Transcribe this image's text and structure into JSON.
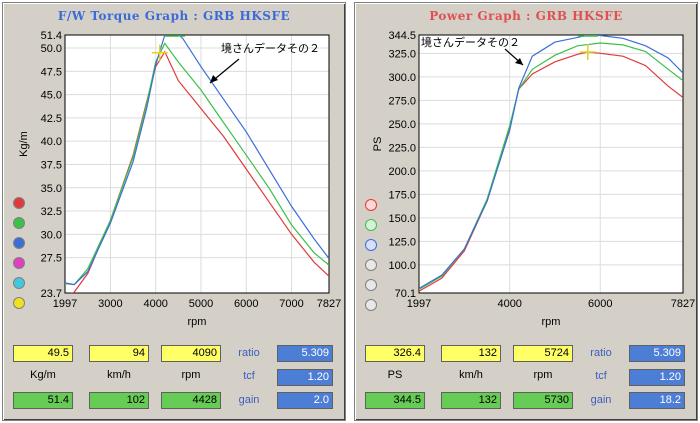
{
  "left": {
    "title": "F/W Torque Graph : GRB HKSFE",
    "title_color": "#3b6bd6",
    "y_axis_label": "Kg/m",
    "x_axis_label": "rpm",
    "y_ticks": [
      "51.4",
      "50.0",
      "47.5",
      "45.0",
      "42.5",
      "40.0",
      "37.5",
      "35.0",
      "32.5",
      "30.0",
      "27.5",
      "23.7"
    ],
    "x_ticks": [
      "1997",
      "3000",
      "4000",
      "5000",
      "6000",
      "7000",
      "7827"
    ],
    "annotation": "境さんデータその２",
    "readouts": {
      "row1": [
        "49.5",
        "94",
        "4090"
      ],
      "units": [
        "Kg/m",
        "km/h",
        "rpm"
      ],
      "row2": [
        "51.4",
        "102",
        "4428"
      ],
      "side_labels": [
        "ratio",
        "tcf",
        "gain"
      ],
      "side_values": [
        "5.309",
        "1.20",
        "2.0"
      ]
    }
  },
  "right": {
    "title": "Power Graph : GRB HKSFE",
    "title_color": "#e05050",
    "y_axis_label": "PS",
    "x_axis_label": "rpm",
    "y_ticks": [
      "344.5",
      "325.0",
      "300.0",
      "275.0",
      "250.0",
      "225.0",
      "200.0",
      "175.0",
      "150.0",
      "125.0",
      "100.0",
      "70.1"
    ],
    "x_ticks": [
      "1997",
      "4000",
      "6000",
      "7827"
    ],
    "annotation": "境さんデータその２",
    "readouts": {
      "row1": [
        "326.4",
        "132",
        "5724"
      ],
      "units": [
        "PS",
        "km/h",
        "rpm"
      ],
      "row2": [
        "344.5",
        "132",
        "5730"
      ],
      "side_labels": [
        "ratio",
        "tcf",
        "gain"
      ],
      "side_values": [
        "5.309",
        "1.20",
        "18.2"
      ]
    }
  },
  "colors": {
    "red": "#e03a3a",
    "green": "#3cc04a",
    "blue": "#3a6fd8"
  },
  "chart_data": [
    {
      "type": "line",
      "title": "F/W Torque Graph : GRB HKSFE",
      "xlabel": "rpm",
      "ylabel": "Kg/m",
      "xlim": [
        1997,
        7827
      ],
      "ylim": [
        23.7,
        51.4
      ],
      "series": [
        {
          "color": "#e03a3a",
          "x": [
            1997,
            2200,
            2500,
            3000,
            3500,
            3800,
            4000,
            4200,
            4500,
            5000,
            5500,
            6000,
            6500,
            7000,
            7500,
            7827
          ],
          "y": [
            23.3,
            23.8,
            25.8,
            31.5,
            38.5,
            44.2,
            48.0,
            49.6,
            46.5,
            43.5,
            40.5,
            37.0,
            33.5,
            30.0,
            27.0,
            25.5
          ]
        },
        {
          "color": "#3cc04a",
          "x": [
            1997,
            2200,
            2500,
            3000,
            3500,
            3800,
            4000,
            4200,
            4500,
            5000,
            5500,
            6000,
            6500,
            7000,
            7500,
            7827
          ],
          "y": [
            24.7,
            24.6,
            26.3,
            31.5,
            38.3,
            44.0,
            48.5,
            50.5,
            48.5,
            45.5,
            42.0,
            38.5,
            35.0,
            31.0,
            28.0,
            26.7
          ]
        },
        {
          "color": "#3a6fd8",
          "x": [
            1997,
            2200,
            2500,
            3000,
            3500,
            3800,
            4000,
            4200,
            4400,
            4600,
            5000,
            5500,
            6000,
            6500,
            7000,
            7500,
            7827
          ],
          "y": [
            24.8,
            24.6,
            26.0,
            31.2,
            37.8,
            43.5,
            48.2,
            51.4,
            52.0,
            51.0,
            48.0,
            44.5,
            41.0,
            37.0,
            33.0,
            29.5,
            27.4
          ]
        }
      ]
    },
    {
      "type": "line",
      "title": "Power Graph : GRB HKSFE",
      "xlabel": "rpm",
      "ylabel": "PS",
      "xlim": [
        1997,
        7827
      ],
      "ylim": [
        70.1,
        344.5
      ],
      "series": [
        {
          "color": "#e03a3a",
          "x": [
            1997,
            2500,
            3000,
            3500,
            4000,
            4200,
            4500,
            5000,
            5500,
            5724,
            6000,
            6500,
            7000,
            7500,
            7827
          ],
          "y": [
            72,
            86,
            115,
            168,
            246,
            287,
            303,
            316,
            324,
            326.4,
            325,
            322,
            312,
            290,
            278
          ]
        },
        {
          "color": "#3cc04a",
          "x": [
            1997,
            2500,
            3000,
            3500,
            4000,
            4200,
            4500,
            5000,
            5500,
            6000,
            6500,
            7000,
            7500,
            7827
          ],
          "y": [
            74,
            88,
            117,
            170,
            248,
            287,
            308,
            323,
            333,
            336,
            334,
            327,
            308,
            296
          ]
        },
        {
          "color": "#3a6fd8",
          "x": [
            1997,
            2500,
            3000,
            3500,
            4000,
            4200,
            4500,
            5000,
            5500,
            5730,
            6000,
            6500,
            7000,
            7500,
            7827
          ],
          "y": [
            75,
            89,
            117,
            168,
            243,
            288,
            322,
            337,
            342,
            344.5,
            344,
            341,
            333,
            320,
            304
          ]
        }
      ]
    }
  ]
}
